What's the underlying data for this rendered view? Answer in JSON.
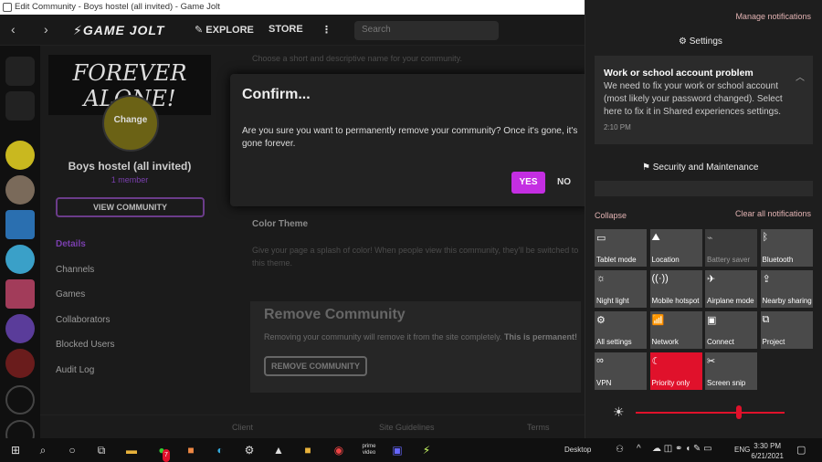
{
  "window": {
    "title": "Edit Community - Boys hostel (all invited) - Game Jolt"
  },
  "nav": {
    "logo": "GAME JOLT",
    "explore": "EXPLORE",
    "store": "STORE",
    "more": "⋮",
    "back": "‹",
    "forward": "›",
    "search_placeholder": "Search"
  },
  "community": {
    "banner_text": "FOREVER ALONE!",
    "change_label": "Change",
    "name": "Boys hostel (all invited)",
    "members": "1 member",
    "view_button": "VIEW COMMUNITY"
  },
  "sidebar": {
    "items": [
      {
        "label": "Details"
      },
      {
        "label": "Channels"
      },
      {
        "label": "Games"
      },
      {
        "label": "Collaborators"
      },
      {
        "label": "Blocked Users"
      },
      {
        "label": "Audit Log"
      }
    ]
  },
  "form": {
    "name_hint": "Choose a short and descriptive name for your community.",
    "color_theme_title": "Color Theme",
    "color_theme_desc": "Give your page a splash of color! When people view this community, they'll be switched to this theme."
  },
  "remove": {
    "title": "Remove Community",
    "desc": "Removing your community will remove it from the site completely.",
    "desc_bold": "This is permanent!",
    "button": "REMOVE COMMUNITY"
  },
  "footer": {
    "client": "Client",
    "guidelines": "Site Guidelines",
    "terms": "Terms"
  },
  "modal": {
    "title": "Confirm...",
    "body": "Are you sure you want to permanently remove your community? Once it's gone, it's gone forever.",
    "yes": "YES",
    "no": "NO"
  },
  "action_center": {
    "manage": "Manage notifications",
    "settings_header": "Settings",
    "notification": {
      "title": "Work or school account problem",
      "body": "We need to fix your work or school account (most likely your password changed). Select here to fix it in Shared experiences settings.",
      "time": "2:10 PM"
    },
    "security_header": "Security and Maintenance",
    "collapse": "Collapse",
    "clear_all": "Clear all notifications",
    "tiles": [
      {
        "label": "Tablet mode",
        "icon": "tablet-icon",
        "glyph": "▭"
      },
      {
        "label": "Location",
        "icon": "location-icon",
        "glyph": "⛰"
      },
      {
        "label": "Battery saver",
        "icon": "battery-icon",
        "glyph": "⌁"
      },
      {
        "label": "Bluetooth",
        "icon": "bluetooth-icon",
        "glyph": "ᛒ"
      },
      {
        "label": "Night light",
        "icon": "sun-icon",
        "glyph": "☼"
      },
      {
        "label": "Mobile hotspot",
        "icon": "hotspot-icon",
        "glyph": "((·))"
      },
      {
        "label": "Airplane mode",
        "icon": "airplane-icon",
        "glyph": "✈"
      },
      {
        "label": "Nearby sharing",
        "icon": "share-icon",
        "glyph": "⇪"
      },
      {
        "label": "All settings",
        "icon": "gear-icon",
        "glyph": "⚙"
      },
      {
        "label": "Network",
        "icon": "network-icon",
        "glyph": "📶"
      },
      {
        "label": "Connect",
        "icon": "connect-icon",
        "glyph": "▣"
      },
      {
        "label": "Project",
        "icon": "project-icon",
        "glyph": "⧉"
      },
      {
        "label": "VPN",
        "icon": "vpn-icon",
        "glyph": "∞"
      },
      {
        "label": "Priority only",
        "icon": "moon-icon",
        "glyph": "☾"
      },
      {
        "label": "Screen snip",
        "icon": "snip-icon",
        "glyph": "✂"
      }
    ],
    "brightness_icon": "☀"
  },
  "taskbar": {
    "desktop": "Desktop",
    "lang": "ENG",
    "time": "3:30 PM",
    "date": "6/21/2021",
    "whatsapp_badge": "7",
    "prime": "prime video"
  },
  "colors": {
    "accent_purple": "#c42ee2",
    "priority_red": "#e0112b"
  }
}
